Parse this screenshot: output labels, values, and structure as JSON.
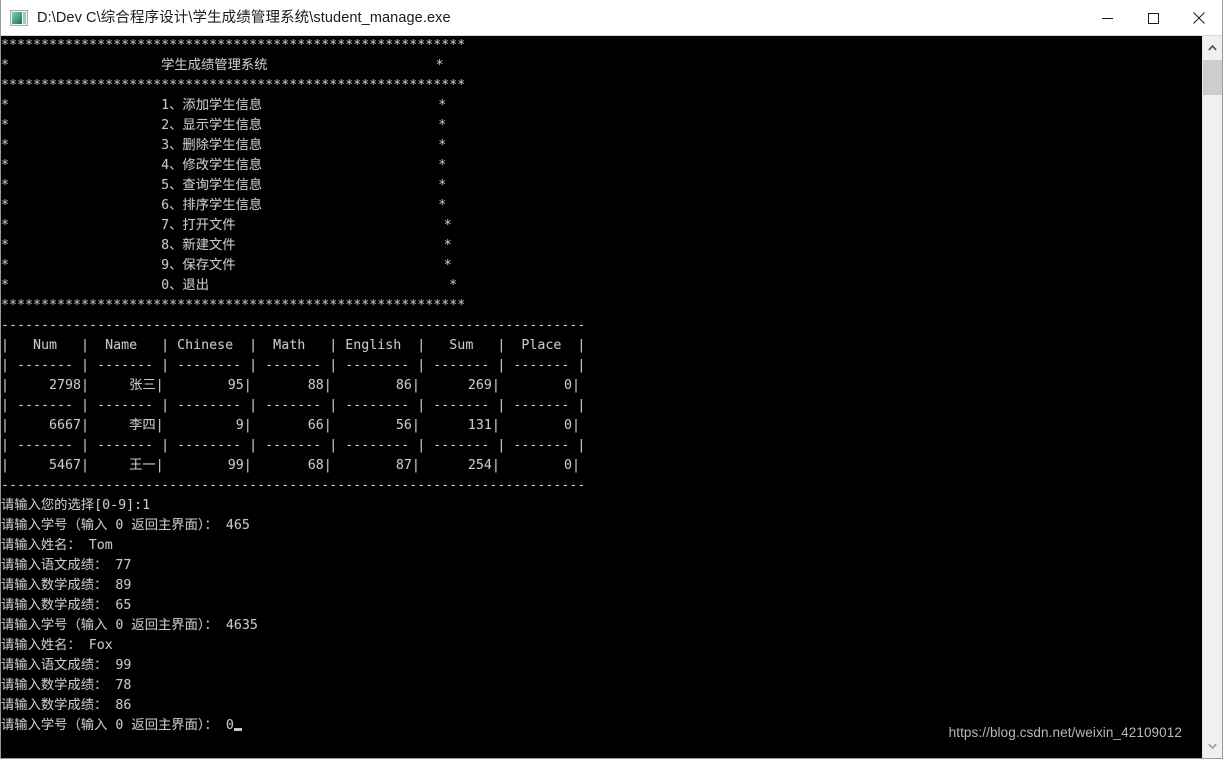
{
  "window": {
    "title": "D:\\Dev C\\综合程序设计\\学生成绩管理系统\\student_manage.exe",
    "icon": "console-app-icon",
    "minimize_label": "Minimize",
    "maximize_label": "Maximize",
    "close_label": "Close"
  },
  "console": {
    "background": "#000000",
    "foreground": "#c8c8c8",
    "menu": {
      "border_char": "*",
      "border_line": "**********************************************************",
      "title": "学生成绩管理系统",
      "items": [
        "1、添加学生信息",
        "2、显示学生信息",
        "3、删除学生信息",
        "4、修改学生信息",
        "5、查询学生信息",
        "6、排序学生信息",
        "7、打开文件",
        "8、新建文件",
        "9、保存文件",
        "0、退出"
      ]
    },
    "table": {
      "headers": [
        "Num",
        "Name",
        "Chinese",
        "Math",
        "English",
        "Sum",
        "Place"
      ],
      "rows": [
        [
          "2798",
          "张三",
          "95",
          "88",
          "86",
          "269",
          "0"
        ],
        [
          "6667",
          "李四",
          "9",
          "66",
          "56",
          "131",
          "0"
        ],
        [
          "5467",
          "王一",
          "99",
          "68",
          "87",
          "254",
          "0"
        ]
      ]
    },
    "session": [
      {
        "prompt": "请输入您的选择[0-9]:",
        "value": "1"
      },
      {
        "prompt": "请输入学号（输入 0 返回主界面）： ",
        "value": "465"
      },
      {
        "prompt": "请输入姓名： ",
        "value": "Tom"
      },
      {
        "prompt": "请输入语文成绩： ",
        "value": "77"
      },
      {
        "prompt": "请输入数学成绩： ",
        "value": "89"
      },
      {
        "prompt": "请输入数学成绩： ",
        "value": "65"
      },
      {
        "prompt": "请输入学号（输入 0 返回主界面）： ",
        "value": "4635"
      },
      {
        "prompt": "请输入姓名： ",
        "value": "Fox"
      },
      {
        "prompt": "请输入语文成绩： ",
        "value": "99"
      },
      {
        "prompt": "请输入数学成绩： ",
        "value": "78"
      },
      {
        "prompt": "请输入数学成绩： ",
        "value": "86"
      },
      {
        "prompt": "请输入学号（输入 0 返回主界面）： ",
        "value": "0"
      }
    ]
  },
  "watermark": "https://blog.csdn.net/weixin_42109012",
  "scrollbar": {
    "up_arrow": "chevron-up-icon",
    "down_arrow": "chevron-down-icon",
    "thumb_position_percent": 3
  }
}
